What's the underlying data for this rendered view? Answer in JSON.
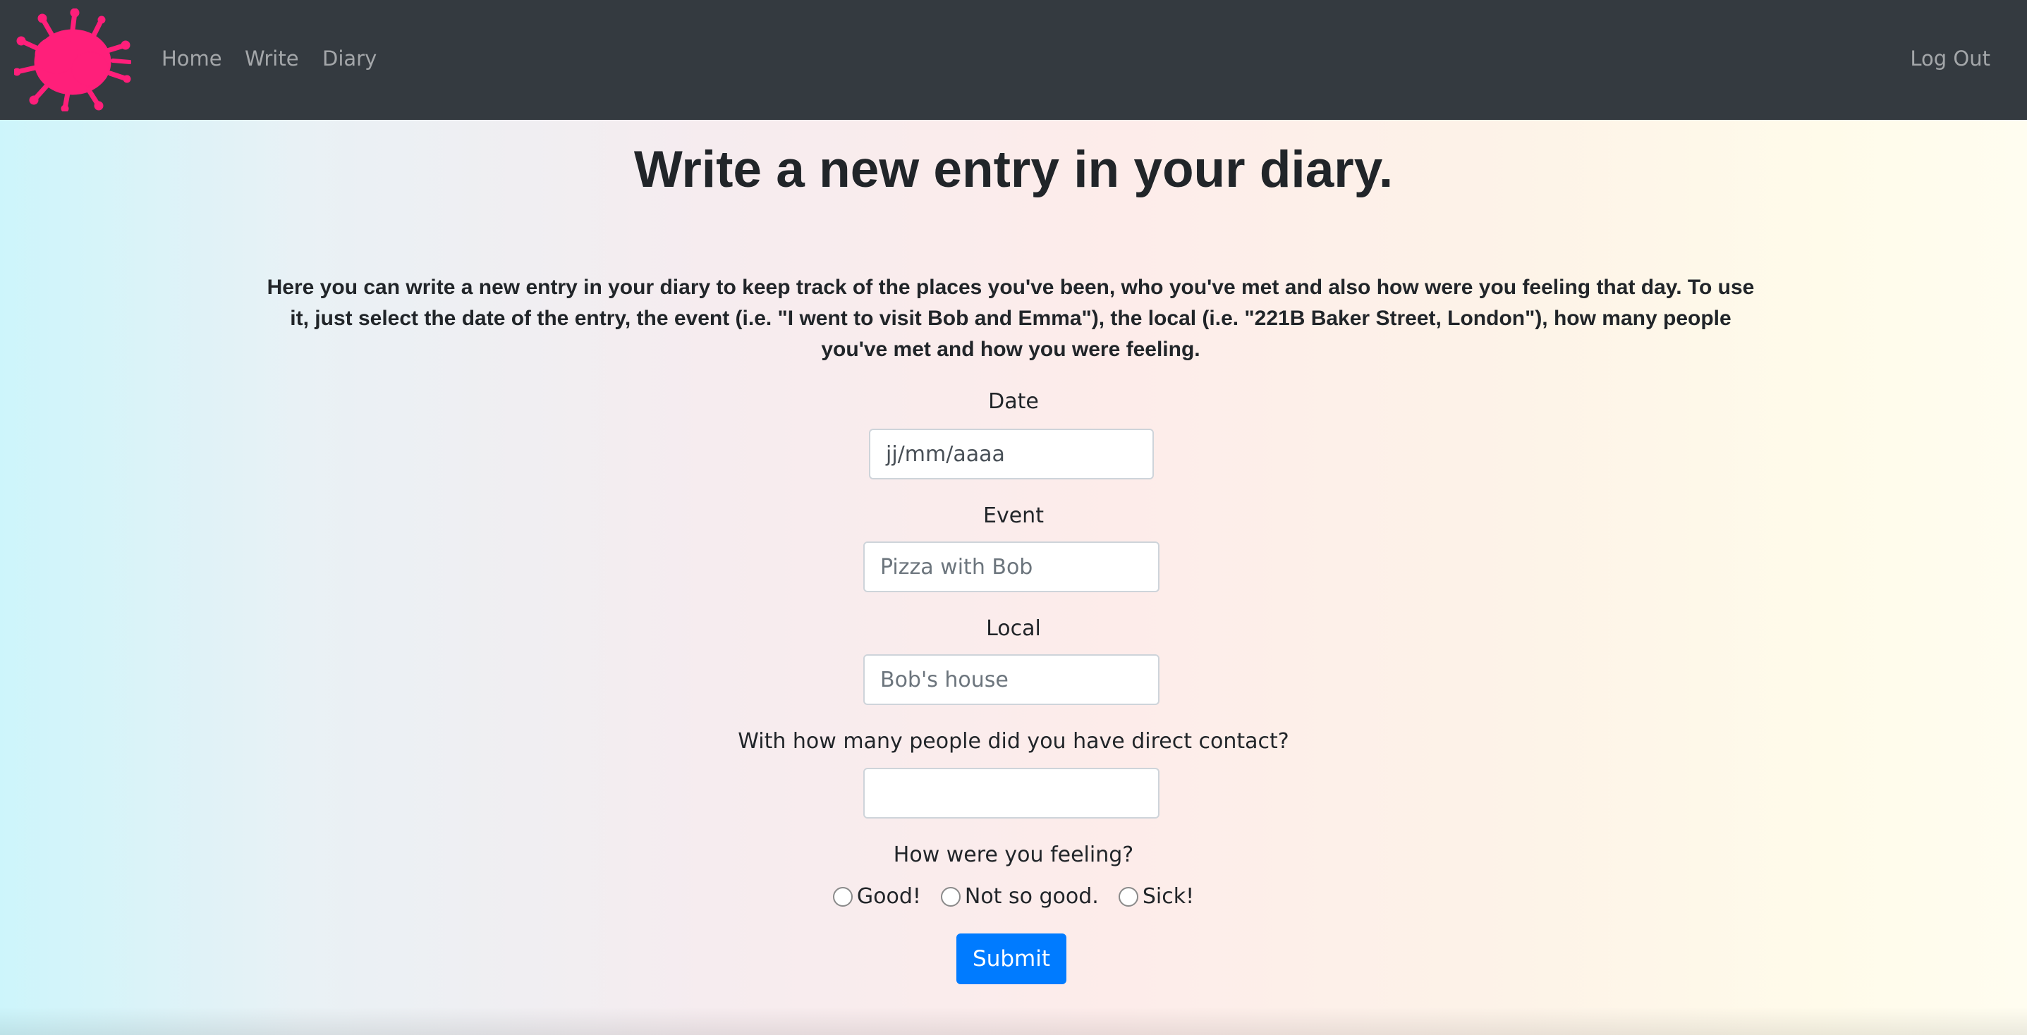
{
  "nav": {
    "logo_icon": "virus-splat-icon",
    "logo_color": "#ff1f7a",
    "home": "Home",
    "write": "Write",
    "diary": "Diary",
    "logout": "Log Out"
  },
  "page": {
    "title": "Write a new entry in your diary.",
    "intro": "Here you can write a new entry in your diary to keep track of the places you've been, who you've met and also how were you feeling that day. To use it, just select the date of the entry, the event (i.e. \"I went to visit Bob and Emma\"), the local (i.e. \"221B Baker Street, London\"), how many people you've met and how you were feeling."
  },
  "form": {
    "date_label": "Date",
    "date_placeholder": "jj/mm/aaaa",
    "event_label": "Event",
    "event_placeholder": "Pizza with Bob",
    "local_label": "Local",
    "local_placeholder": "Bob's house",
    "contact_label": "With how many people did you have direct contact?",
    "contact_value": "",
    "feeling_label": "How were you feeling?",
    "feeling_options": [
      "Good!",
      "Not so good.",
      "Sick!"
    ],
    "submit_label": "Submit",
    "accent_color": "#007bff"
  }
}
